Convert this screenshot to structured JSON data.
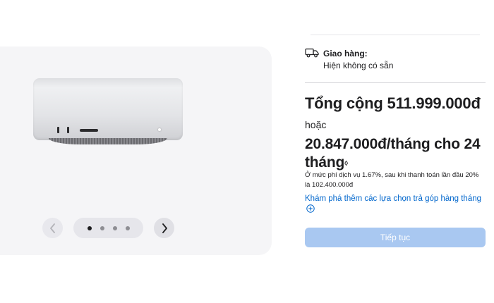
{
  "gallery": {
    "dots_count": 4,
    "active_index": 0
  },
  "delivery": {
    "title": "Giao hàng:",
    "status": "Hiện không có sẵn"
  },
  "pricing": {
    "total": "Tổng cộng 511.999.000đ",
    "or": "hoặc",
    "monthly": "20.847.000đ/tháng cho 24 tháng",
    "footnote_mark": "◊",
    "note": "Ở mức phí dịch vụ 1.67%, sau khi thanh toán lần đầu 20% là 102.400.000đ",
    "explore_link": "Khám phá thêm các lựa chọn trả góp hàng tháng"
  },
  "actions": {
    "continue_label": "Tiếp tục"
  },
  "colors": {
    "accent_link": "#0066cc",
    "button_disabled": "#a9c8f1",
    "gallery_bg": "#f5f5f7"
  }
}
